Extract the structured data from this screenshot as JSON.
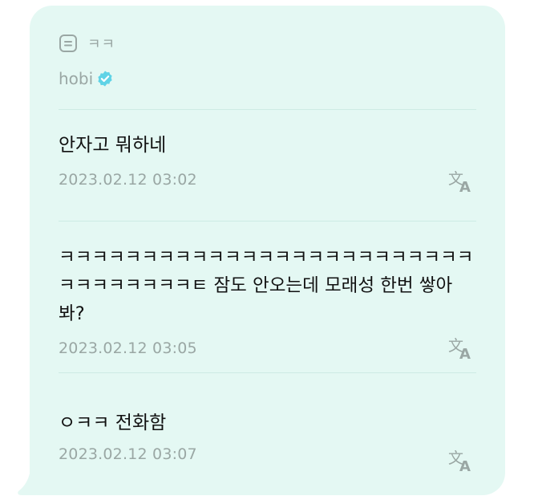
{
  "header": {
    "quote_icon": "list-quote-icon",
    "quote_text": "ㅋㅋ",
    "author": "hobi",
    "verified_icon": "verified-badge-icon"
  },
  "messages": [
    {
      "text": "안자고 뭐하네",
      "time": "2023.02.12 03:02",
      "translate_icon": "translate-icon"
    },
    {
      "text": "ㅋㅋㅋㅋㅋㅋㅋㅋㅋㅋㅋㅋㅋㅋㅋㅋㅋㅋㅋㅋㅋㅋㅋㅋㅋㅋㅋㅋㅋㅋㅋㅋㅋㅌ 잠도 안오는데 모래성 한번 쌓아 봐?",
      "time": "2023.02.12 03:05",
      "translate_icon": "translate-icon"
    },
    {
      "text": "ㅇㅋㅋ 전화함",
      "time": "2023.02.12 03:07",
      "translate_icon": "translate-icon"
    }
  ],
  "colors": {
    "bubble_bg": "#e4f8f3",
    "muted_text": "#9aa7a4",
    "verified": "#5fd3e6",
    "message_text": "#111111"
  }
}
